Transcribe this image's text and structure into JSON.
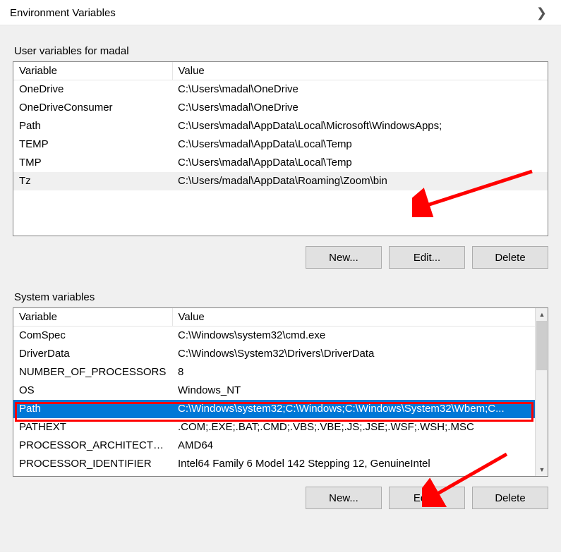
{
  "dialog": {
    "title": "Environment Variables"
  },
  "user_section": {
    "label": "User variables for madal",
    "columns": {
      "variable": "Variable",
      "value": "Value"
    },
    "rows": [
      {
        "variable": "OneDrive",
        "value": "C:\\Users\\madal\\OneDrive"
      },
      {
        "variable": "OneDriveConsumer",
        "value": "C:\\Users\\madal\\OneDrive"
      },
      {
        "variable": "Path",
        "value": "C:\\Users\\madal\\AppData\\Local\\Microsoft\\WindowsApps;"
      },
      {
        "variable": "TEMP",
        "value": "C:\\Users\\madal\\AppData\\Local\\Temp"
      },
      {
        "variable": "TMP",
        "value": "C:\\Users\\madal\\AppData\\Local\\Temp"
      },
      {
        "variable": "Tz",
        "value": "C:\\Users/madal\\AppData\\Roaming\\Zoom\\bin",
        "highlight": true
      }
    ],
    "buttons": {
      "new": "New...",
      "edit": "Edit...",
      "delete": "Delete"
    }
  },
  "system_section": {
    "label": "System variables",
    "columns": {
      "variable": "Variable",
      "value": "Value"
    },
    "rows": [
      {
        "variable": "ComSpec",
        "value": "C:\\Windows\\system32\\cmd.exe"
      },
      {
        "variable": "DriverData",
        "value": "C:\\Windows\\System32\\Drivers\\DriverData"
      },
      {
        "variable": "NUMBER_OF_PROCESSORS",
        "value": "8"
      },
      {
        "variable": "OS",
        "value": "Windows_NT"
      },
      {
        "variable": "Path",
        "value": "C:\\Windows\\system32;C:\\Windows;C:\\Windows\\System32\\Wbem;C...",
        "selected": true
      },
      {
        "variable": "PATHEXT",
        "value": ".COM;.EXE;.BAT;.CMD;.VBS;.VBE;.JS;.JSE;.WSF;.WSH;.MSC"
      },
      {
        "variable": "PROCESSOR_ARCHITECTURE",
        "value": "AMD64"
      },
      {
        "variable": "PROCESSOR_IDENTIFIER",
        "value": "Intel64 Family 6 Model 142 Stepping 12, GenuineIntel"
      }
    ],
    "buttons": {
      "new": "New...",
      "edit": "Edit...",
      "delete": "Delete"
    }
  },
  "annotations": {
    "arrow_color": "#ff0000"
  }
}
